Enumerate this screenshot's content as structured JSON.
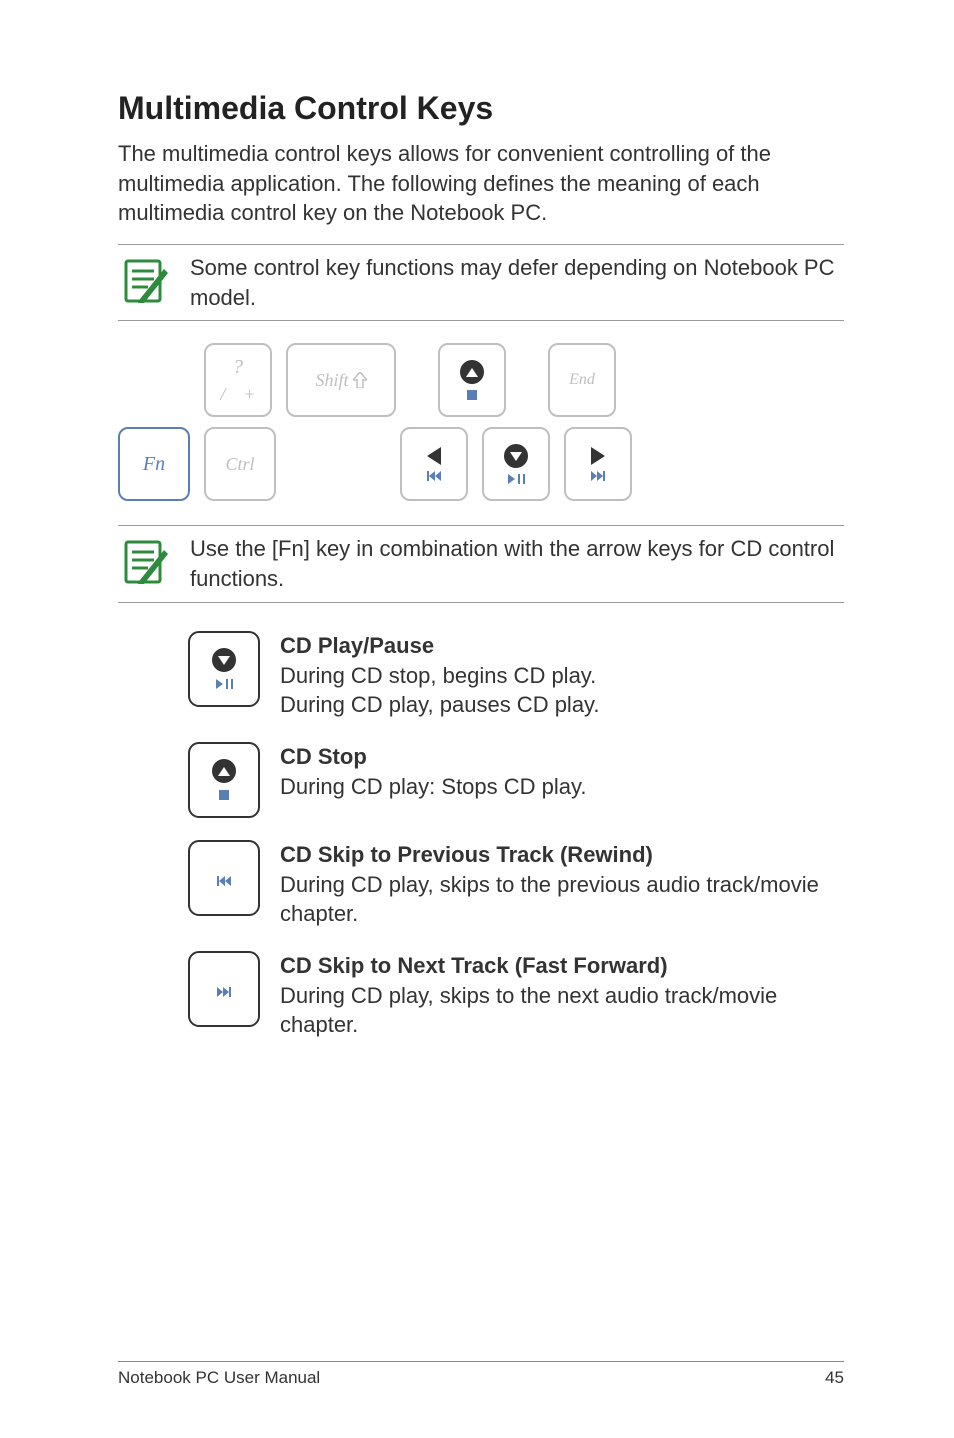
{
  "heading": "Multimedia Control Keys",
  "intro": "The multimedia control keys allows for convenient controlling of the multimedia application. The following defines the meaning of each multimedia control key on the Notebook PC.",
  "note1": "Some control key functions may defer depending on Notebook PC model.",
  "note2": "Use the [Fn] key in combination with the arrow keys for CD control functions.",
  "keys": {
    "question_top": "?",
    "question_slash": "/",
    "question_plus": "+",
    "shift": "Shift",
    "end": "End",
    "fn": "Fn",
    "ctrl": "Ctrl"
  },
  "functions": [
    {
      "title": "CD Play/Pause",
      "lines": [
        "During CD stop, begins CD play.",
        "During CD play, pauses CD play."
      ]
    },
    {
      "title": "CD Stop",
      "lines": [
        "During CD play: Stops CD play."
      ]
    },
    {
      "title": "CD Skip to Previous Track (Rewind)",
      "lines": [
        "During CD play, skips to the previous audio track/movie chapter."
      ]
    },
    {
      "title": "CD Skip to Next Track (Fast Forward)",
      "lines": [
        "During CD play, skips to the next audio track/movie chapter."
      ]
    }
  ],
  "footer": {
    "left": "Notebook PC User Manual",
    "right": "45"
  }
}
